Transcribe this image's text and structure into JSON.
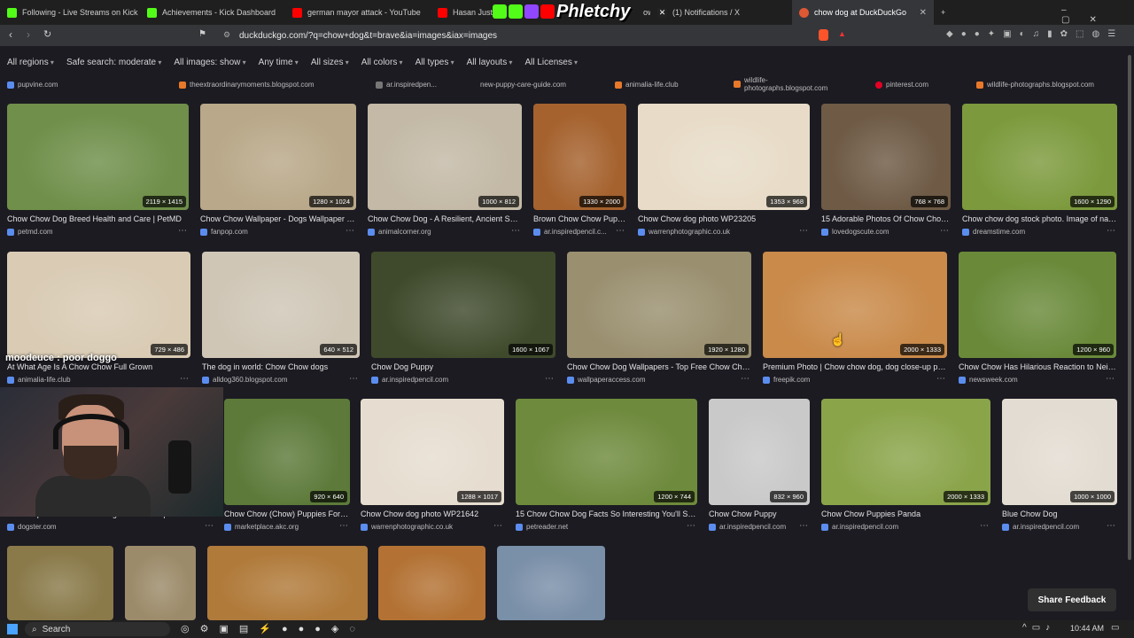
{
  "tabs": [
    {
      "title": "Following - Live Streams on Kick",
      "color": "#53fc18"
    },
    {
      "title": "Achievements - Kick Dashboard",
      "color": "#53fc18"
    },
    {
      "title": "german mayor attack - YouTube",
      "color": "#ff0000"
    },
    {
      "title": "Hasan Just",
      "color": "#ff0000"
    },
    {
      "title": "own a YouTubers Home",
      "color": "#ff0000"
    },
    {
      "title": "(1) Notifications / X",
      "color": "#ffffff"
    },
    {
      "title": "chow dog at DuckDuckGo",
      "color": "#de5833",
      "active": true
    }
  ],
  "logo_text": "Phletchy",
  "address_bar": "duckduckgo.com/?q=chow+dog&t=brave&ia=images&iax=images",
  "filters": [
    "All regions",
    "Safe search: moderate",
    "All images: show",
    "Any time",
    "All sizes",
    "All colors",
    "All types",
    "All layouts",
    "All Licenses"
  ],
  "top_sources": [
    "pupvine.com",
    "theextraordinarymoments.blogspot.com",
    "ar.inspiredpen...",
    "new-puppy-care-guide.com",
    "animalia-life.club",
    "wildlife-photographs.blogspot.com",
    "pinterest.com",
    "wildlife-photographs.blogspot.com"
  ],
  "results": [
    {
      "caption": "Chow Chow Dog Breed Health and Care | PetMD",
      "source": "petmd.com",
      "dims": "2119 × 1415",
      "color": "#6f8f4a"
    },
    {
      "caption": "Chow Chow Wallpaper - Dogs Wallpaper (1...",
      "source": "fanpop.com",
      "dims": "1280 × 1024",
      "color": "#b9a889"
    },
    {
      "caption": "Chow Chow Dog - A Resilient, Ancient Spit...",
      "source": "animalcorner.org",
      "dims": "1000 × 812",
      "color": "#c3b9a6"
    },
    {
      "caption": "Brown Chow Chow Pupp...",
      "source": "ar.inspiredpencil.c...",
      "dims": "1330 × 2000",
      "color": "#a5622e"
    },
    {
      "caption": "Chow Chow dog photo WP23205",
      "source": "warrenphotographic.co.uk",
      "dims": "1353 × 968",
      "color": "#e8dcc8"
    },
    {
      "caption": "15 Adorable Photos Of Chow Chow...",
      "source": "lovedogscute.com",
      "dims": "768 × 768",
      "color": "#6e5a45"
    },
    {
      "caption": "Chow chow dog stock photo. Image of nat...",
      "source": "dreamstime.com",
      "dims": "1600 × 1290",
      "color": "#7c9a3d"
    },
    {
      "caption": "At What Age Is A Chow Chow Full Grown",
      "source": "animalia-life.club",
      "dims": "729 × 486",
      "color": "#d9cbb4"
    },
    {
      "caption": "The dog in world: Chow Chow dogs",
      "source": "alldog360.blogspot.com",
      "dims": "640 × 512",
      "color": "#cfc6b6"
    },
    {
      "caption": "Chow Dog Puppy",
      "source": "ar.inspiredpencil.com",
      "dims": "1600 × 1067",
      "color": "#3f4a2c"
    },
    {
      "caption": "Chow Chow Dog Wallpapers - Top Free Chow Cho...",
      "source": "wallpaperaccess.com",
      "dims": "1920 × 1280",
      "color": "#9a9070"
    },
    {
      "caption": "Premium Photo | Chow chow dog, dog close-up por...",
      "source": "freepik.com",
      "dims": "2000 × 1333",
      "color": "#c98a4a"
    },
    {
      "caption": "Chow Chow Has Hilarious Reaction to Neig...",
      "source": "newsweek.com",
      "dims": "1200 × 960",
      "color": "#6a8a3a"
    },
    {
      "caption": "200+ Popular Chow Chow Dog Names: Unique...",
      "source": "dogster.com",
      "dims": "",
      "color": "#555"
    },
    {
      "caption": "Chow Chow (Chow) Puppies For Sale",
      "source": "marketplace.akc.org",
      "dims": "920 × 640",
      "color": "#5d7a3a"
    },
    {
      "caption": "Chow Chow dog photo WP21642",
      "source": "warrenphotographic.co.uk",
      "dims": "1288 × 1017",
      "color": "#e6ddd0"
    },
    {
      "caption": "15 Chow Chow Dog Facts So Interesting You'll Say,...",
      "source": "petreader.net",
      "dims": "1200 × 744",
      "color": "#6e8a3c"
    },
    {
      "caption": "Chow Chow Puppy",
      "source": "ar.inspiredpencil.com",
      "dims": "832 × 960",
      "color": "#c9c9c9"
    },
    {
      "caption": "Chow Chow Puppies Panda",
      "source": "ar.inspiredpencil.com",
      "dims": "2000 × 1333",
      "color": "#8aa44a"
    },
    {
      "caption": "Blue Chow Dog",
      "source": "ar.inspiredpencil.com",
      "dims": "1000 × 1000",
      "color": "#e3dcd2"
    },
    {
      "caption": "",
      "source": "",
      "dims": "",
      "color": "#8a7a4a"
    },
    {
      "caption": "",
      "source": "",
      "dims": "",
      "color": "#9c8b6a"
    },
    {
      "caption": "",
      "source": "",
      "dims": "",
      "color": "#b07a3a"
    },
    {
      "caption": "",
      "source": "",
      "dims": "",
      "color": "#b37234"
    },
    {
      "caption": "",
      "source": "",
      "dims": "",
      "color": "#7a8fa8"
    }
  ],
  "chat_overlay": "moodeuce : poor doggo",
  "share_feedback": "Share Feedback",
  "taskbar": {
    "search": "Search",
    "time": "10:44 AM"
  }
}
